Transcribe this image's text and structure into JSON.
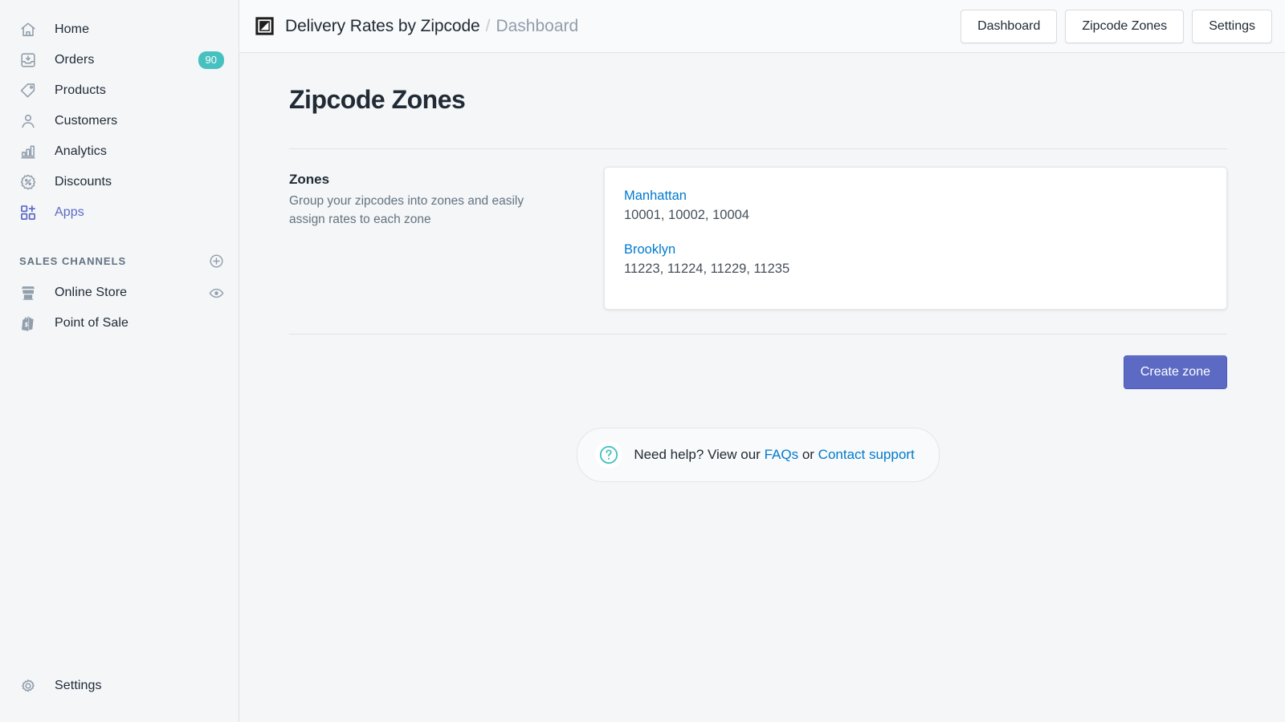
{
  "sidebar": {
    "items": [
      {
        "label": "Home",
        "icon": "home-icon",
        "badge": null,
        "active": false
      },
      {
        "label": "Orders",
        "icon": "orders-inbox-icon",
        "badge": "90",
        "active": false
      },
      {
        "label": "Products",
        "icon": "products-tag-icon",
        "badge": null,
        "active": false
      },
      {
        "label": "Customers",
        "icon": "customers-person-icon",
        "badge": null,
        "active": false
      },
      {
        "label": "Analytics",
        "icon": "analytics-bar-chart-icon",
        "badge": null,
        "active": false
      },
      {
        "label": "Discounts",
        "icon": "discounts-percent-icon",
        "badge": null,
        "active": false
      },
      {
        "label": "Apps",
        "icon": "apps-grid-plus-icon",
        "badge": null,
        "active": true
      }
    ],
    "section": {
      "title": "SALES CHANNELS",
      "add_icon": "plus-circle-icon",
      "items": [
        {
          "label": "Online Store",
          "icon": "online-store-icon",
          "trailing_icon": "eye-icon"
        },
        {
          "label": "Point of Sale",
          "icon": "point-of-sale-bag-icon",
          "trailing_icon": null
        }
      ]
    },
    "bottom": {
      "label": "Settings",
      "icon": "gear-icon"
    },
    "colors": {
      "badge": "#47c1bf",
      "active": "#5c6ac4",
      "icon": "#919eab"
    }
  },
  "topbar": {
    "app_icon": "app-square-diagonal-icon",
    "app_name": "Delivery Rates by Zipcode",
    "separator": "/",
    "breadcrumb": "Dashboard",
    "buttons": [
      {
        "label": "Dashboard",
        "name": "dashboard"
      },
      {
        "label": "Zipcode Zones",
        "name": "zipcode-zones"
      },
      {
        "label": "Settings",
        "name": "settings"
      }
    ]
  },
  "page": {
    "title": "Zipcode Zones",
    "section": {
      "title": "Zones",
      "description": "Group your zipcodes into zones and easily assign rates to each zone"
    },
    "zones": [
      {
        "name": "Manhattan",
        "zipcodes": "10001, 10002, 10004"
      },
      {
        "name": "Brooklyn",
        "zipcodes": "11223, 11224, 11229, 11235"
      }
    ],
    "primary_action": {
      "label": "Create zone",
      "color": "#5c6ac4"
    }
  },
  "help": {
    "icon": "question-mark-circle-icon",
    "prefix": "Need help? View our",
    "faq_link": "FAQs",
    "conjunction": "or",
    "support_link": "Contact support",
    "icon_color": "#47c1bf"
  }
}
